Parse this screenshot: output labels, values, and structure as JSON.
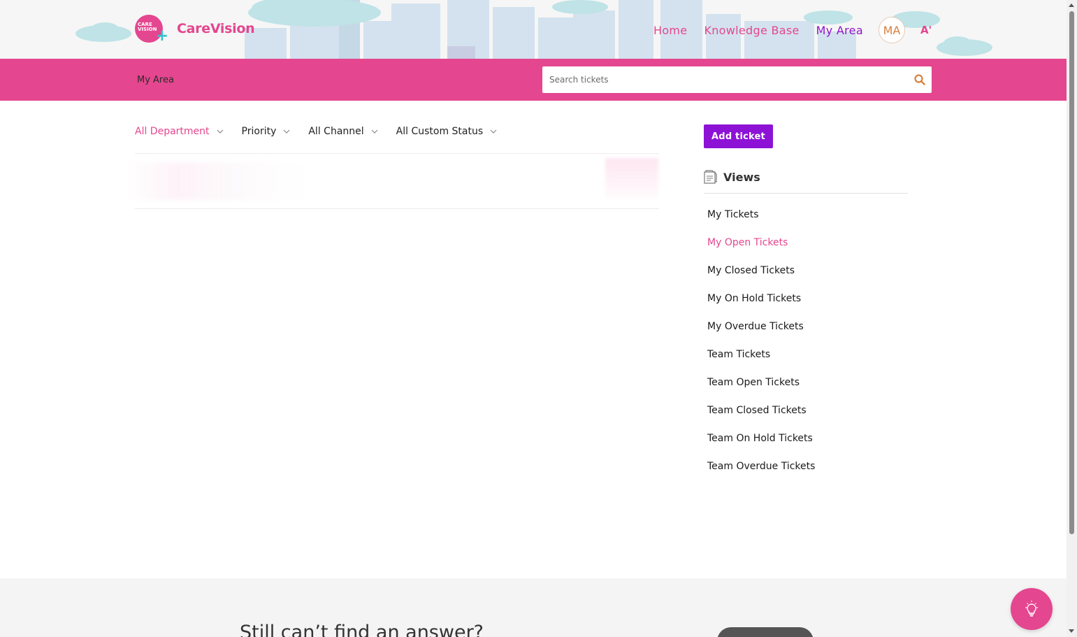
{
  "brand": {
    "badge_line1": "CARE",
    "badge_line2": "VISION",
    "name": "CareVision"
  },
  "nav": {
    "home": "Home",
    "knowledge_base": "Knowledge Base",
    "my_area": "My Area",
    "avatar_initials": "MA",
    "font_toggle": "A'"
  },
  "subheader": {
    "breadcrumb": "My Area",
    "search_placeholder": "Search tickets"
  },
  "filters": [
    {
      "label": "All Department",
      "active": true
    },
    {
      "label": "Priority",
      "active": false
    },
    {
      "label": "All Channel",
      "active": false
    },
    {
      "label": "All Custom Status",
      "active": false
    }
  ],
  "actions": {
    "add_ticket": "Add ticket"
  },
  "views": {
    "title": "Views",
    "items": [
      {
        "label": "My Tickets",
        "active": false
      },
      {
        "label": "My Open Tickets",
        "active": true
      },
      {
        "label": "My Closed Tickets",
        "active": false
      },
      {
        "label": "My On Hold Tickets",
        "active": false
      },
      {
        "label": "My Overdue Tickets",
        "active": false
      },
      {
        "label": "Team Tickets",
        "active": false
      },
      {
        "label": "Team Open Tickets",
        "active": false
      },
      {
        "label": "Team Closed Tickets",
        "active": false
      },
      {
        "label": "Team On Hold Tickets",
        "active": false
      },
      {
        "label": "Team Overdue Tickets",
        "active": false
      }
    ]
  },
  "footer": {
    "prompt": "Still can’t find an answer?"
  },
  "colors": {
    "brand_pink": "#e4468f",
    "accent_purple": "#8d12d6",
    "teal": "#30c4cf",
    "avatar_orange": "#d9803f"
  },
  "icons": {
    "search": "search-icon",
    "chevron": "chevron-down-icon",
    "views": "document-icon",
    "help_fab": "lightbulb-icon"
  }
}
